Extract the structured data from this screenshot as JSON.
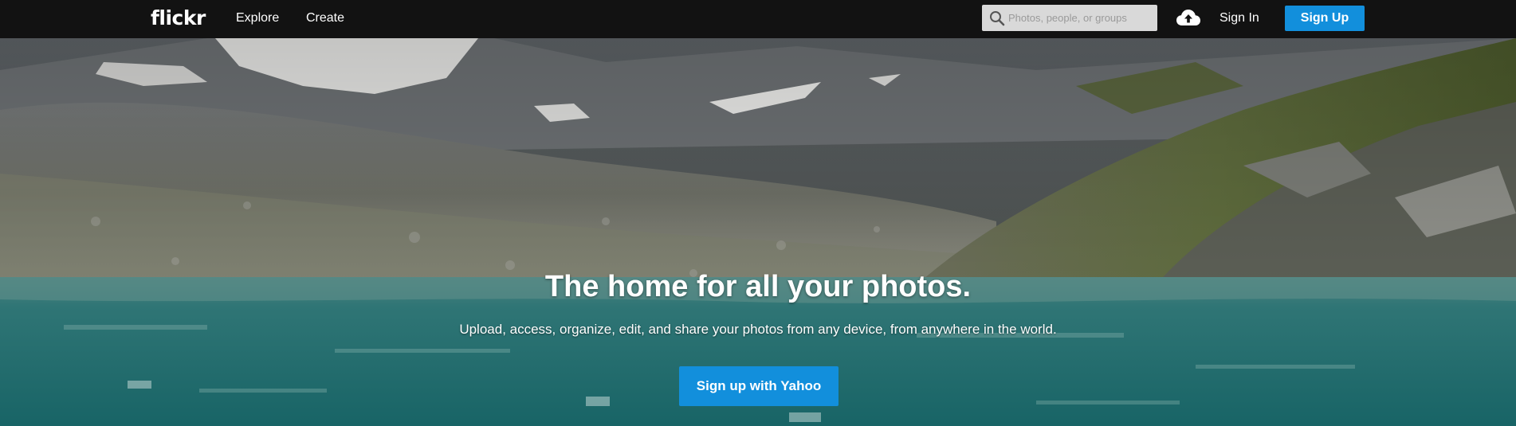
{
  "brand": {
    "logo_text": "flickr"
  },
  "nav": {
    "explore": "Explore",
    "create": "Create",
    "sign_in": "Sign In",
    "sign_up": "Sign Up"
  },
  "search": {
    "placeholder": "Photos, people, or groups",
    "value": ""
  },
  "icons": {
    "search": "magnifier-icon",
    "upload": "cloud-upload-icon"
  },
  "hero": {
    "headline": "The home for all your photos.",
    "subline": "Upload, access, organize, edit, and share your photos from any device, from anywhere in the world.",
    "cta": "Sign up with Yahoo",
    "background": "mountain lake landscape photo"
  },
  "colors": {
    "nav_bg": "#121212",
    "accent_blue": "#128fdc",
    "search_bg": "#d9d9d9"
  }
}
